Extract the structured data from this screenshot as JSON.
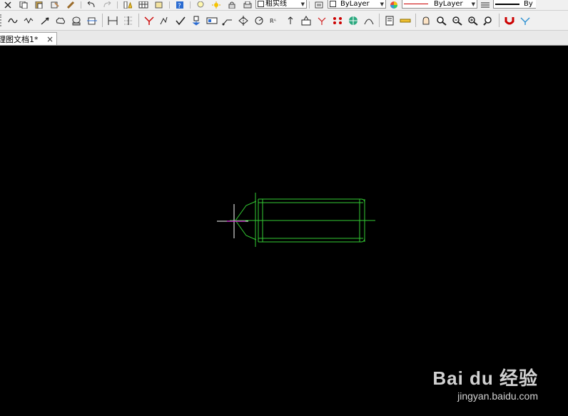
{
  "toolbar_top": {
    "linetype_label": "粗实线",
    "bylayer_color": "ByLayer",
    "bylayer_linetype": "ByLayer",
    "bylayer_lineweight": "By"
  },
  "document_tab": {
    "title": "理图文档1*",
    "close": "×"
  },
  "drawing": {
    "outline_color": "#33cc33",
    "centerline_color": "#33cc33",
    "cursor_color": "#ffffff",
    "highlight_color": "#cc33cc"
  },
  "watermark": {
    "logo_text": "Bai du 经验",
    "url": "jingyan.baidu.com"
  }
}
